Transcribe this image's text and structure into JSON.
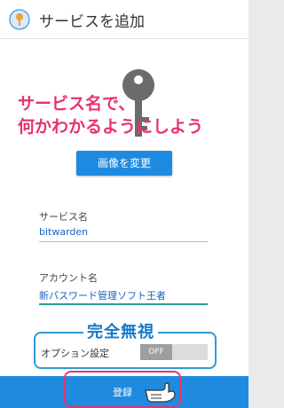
{
  "header": {
    "title": "サービスを追加",
    "icon": "key-circle-icon"
  },
  "image_area": {
    "icon": "key-icon",
    "annotation_line1": "サービス名で、",
    "annotation_line2": "何かわかるようにしよう",
    "change_image_label": "画像を変更"
  },
  "form": {
    "service_label": "サービス名",
    "service_value": "bitwarden",
    "account_label": "アカウント名",
    "account_value": "新パスワード管理ソフト王者"
  },
  "options": {
    "annotation": "完全無視",
    "label": "オプション設定",
    "toggle_state": "OFF"
  },
  "footer": {
    "register_label": "登録",
    "pointer_icon": "hand-pointer-icon"
  },
  "colors": {
    "accent": "#1f8be0",
    "annotation_pink": "#e8336b",
    "annotation_blue": "#1778c9"
  }
}
